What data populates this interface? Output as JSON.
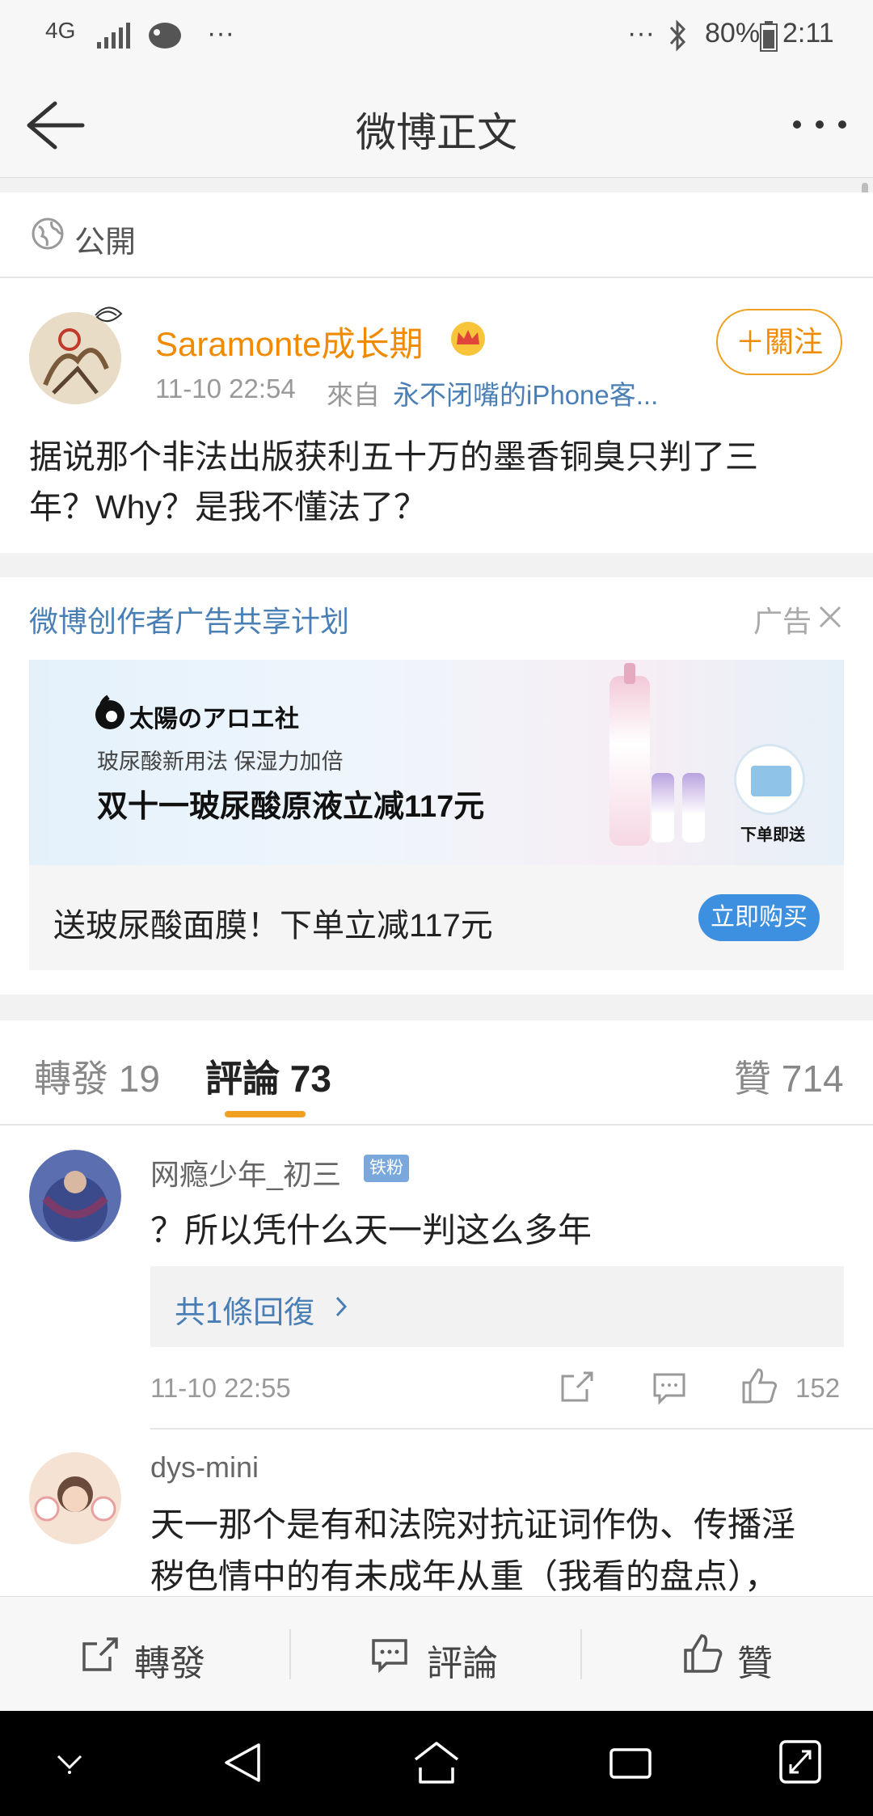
{
  "status_bar": {
    "network": "4G",
    "more_left": "···",
    "more_right": "···",
    "battery": "80%",
    "time": "2:11"
  },
  "nav": {
    "title": "微博正文"
  },
  "post": {
    "visibility": "公開",
    "username": "Saramonte成长期",
    "follow_label": "＋關注",
    "time": "11-10 22:54",
    "source_prefix": "來自",
    "source": "永不闭嘴的iPhone客...",
    "text_line1": "据说那个非法出版获利五十万的墨香铜臭只判了三",
    "text_line2": "年？Why？是我不懂法了？"
  },
  "ad": {
    "sponsor": "微博创作者广告共享计划",
    "ad_tag": "广告",
    "banner_brand": "太陽のアロエ社",
    "banner_sub": "玻尿酸新用法  保湿力加倍",
    "banner_headline": "双十一玻尿酸原液立减117元",
    "banner_badge": "下单即送",
    "caption": "送玻尿酸面膜！下单立减117元",
    "buy_label": "立即购买",
    "colors": {
      "link": "#4a7fb5",
      "buy_button": "#3d8fe0"
    }
  },
  "tabs": {
    "repost": "轉發 19",
    "comments": "評論 73",
    "likes": "贊 714",
    "active_underline_color": "#f0a020"
  },
  "comments": [
    {
      "username": "网瘾少年_初三",
      "badge": "铁粉",
      "text": "？所以凭什么天一判这么多年",
      "replies_label": "共1條回復",
      "time": "11-10 22:55",
      "likes": "152"
    },
    {
      "username": "dys-mini",
      "text_line1": "天一那个是有和法院对抗证词作伪、传播淫",
      "text_line2": "秽色情中的有未成年从重（我看的盘点），"
    }
  ],
  "bottom_bar": {
    "repost": "轉發",
    "comment": "評論",
    "like": "贊"
  },
  "accent_color": "#f08a00"
}
